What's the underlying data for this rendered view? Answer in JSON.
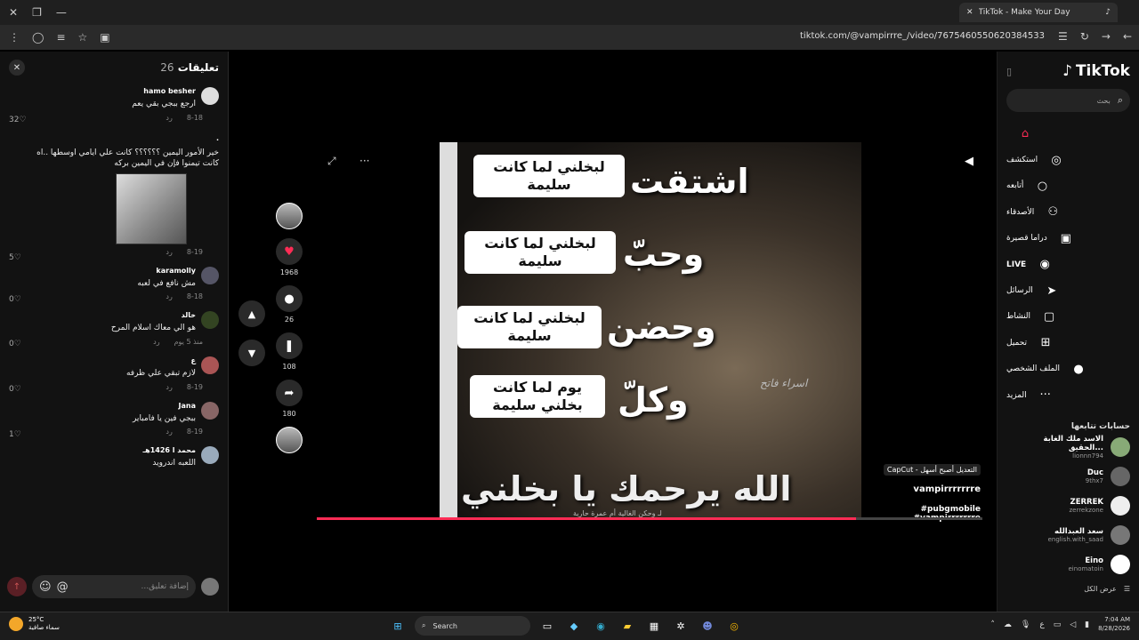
{
  "browser": {
    "tab_title": "TikTok - Make Your Day",
    "url": "tiktok.com/@vampirrre_/video/7675460550620384533"
  },
  "comments": {
    "title": "تعليقات",
    "count": "26",
    "items": [
      {
        "user": "hamo besher",
        "text": "ارجع ببجي بقي يعم",
        "date": "8-18",
        "reply": "رد",
        "likes": "32"
      },
      {
        "user": "·",
        "text": "خير الأمور اليمين ؟؟؟؟؟؟ كانت علي ايامي اوسطها ..اه كانت تيمنوا فإن في اليمين بركه",
        "date": "8-19",
        "reply": "رد",
        "likes": "5"
      },
      {
        "user": "karamolly",
        "text": "مش نافع في لعبه",
        "date": "8-18",
        "reply": "رد",
        "likes": "0"
      },
      {
        "user": "خالد",
        "text": "هو الي معاك اسلام المرح",
        "date": "منذ 5 يوم",
        "reply": "رد",
        "likes": "0"
      },
      {
        "user": "ع",
        "text": "لازم تبقي علي ظرفه",
        "date": "8-19",
        "reply": "رد",
        "likes": "0"
      },
      {
        "user": "Jana",
        "text": "ببجي فين يا فامباير",
        "date": "8-19",
        "reply": "رد",
        "likes": "1"
      },
      {
        "user": "محمد ا 1426هـ",
        "text": "اللعبه اندرويد",
        "date": "",
        "reply": "",
        "likes": ""
      }
    ],
    "input_placeholder": "إضافة تعليق..."
  },
  "video": {
    "words": [
      "اشتقت",
      "وحبّ",
      "وحضن",
      "وكلّ"
    ],
    "bubble_text": "لبخلني لما كانت سليمة",
    "bubble4": "يوم لما كانت بخلني سليمة",
    "bottom_line": "الله يرحمك يا بخلني",
    "watermark": "اسراء فاتح",
    "credit": "لـ وحكن الغالية أم عمرة حارية",
    "capcut": "CapCut - التعديل أصبح أسهل",
    "author": "vampirrrrrrre",
    "tags": "#pubgmobile #vampirrrrrrre",
    "progress": 0.81
  },
  "actions": {
    "likes": "1968",
    "comments": "26",
    "saves": "108",
    "shares": "180"
  },
  "sidebar": {
    "logo": "TikTok",
    "search_placeholder": "بحث",
    "nav": [
      {
        "label": "",
        "icon": "home-icon",
        "glyph": "⌂"
      },
      {
        "label": "استكشف",
        "icon": "compass-icon",
        "glyph": "◎"
      },
      {
        "label": "أتابعه",
        "icon": "following-icon",
        "glyph": "○"
      },
      {
        "label": "الأصدقاء",
        "icon": "friends-icon",
        "glyph": "⚇"
      },
      {
        "label": "دراما قصيرة",
        "icon": "drama-icon",
        "glyph": "▣"
      },
      {
        "label": "LIVE",
        "icon": "live-icon",
        "glyph": "◉"
      },
      {
        "label": "الرسائل",
        "icon": "messages-icon",
        "glyph": "➤"
      },
      {
        "label": "النشاط",
        "icon": "activity-icon",
        "glyph": "▢"
      },
      {
        "label": "تحميل",
        "icon": "upload-icon",
        "glyph": "⊞"
      },
      {
        "label": "الملف الشخصي",
        "icon": "profile-icon",
        "glyph": "●"
      },
      {
        "label": "المزيد",
        "icon": "more-icon",
        "glyph": "···"
      }
    ],
    "following_title": "حسابات تتابعها",
    "following": [
      {
        "name": "الاسد ملك الغابة الحقيق...",
        "handle": "lionnn794"
      },
      {
        "name": "Duc",
        "handle": "9thx7"
      },
      {
        "name": "ZERREK",
        "handle": "zerrekzone"
      },
      {
        "name": "سعد العبدالله",
        "handle": "english.with_saad"
      },
      {
        "name": "Eino",
        "handle": "einomatoin"
      }
    ],
    "see_all": "عرض الكل"
  },
  "taskbar": {
    "temp": "25°C",
    "weather": "سماء صافية",
    "search": "Search",
    "time": "7:04 AM",
    "date": "8/28/2026"
  },
  "colors": {
    "accent": "#fe2c55",
    "highlight": "#f4f06a"
  }
}
